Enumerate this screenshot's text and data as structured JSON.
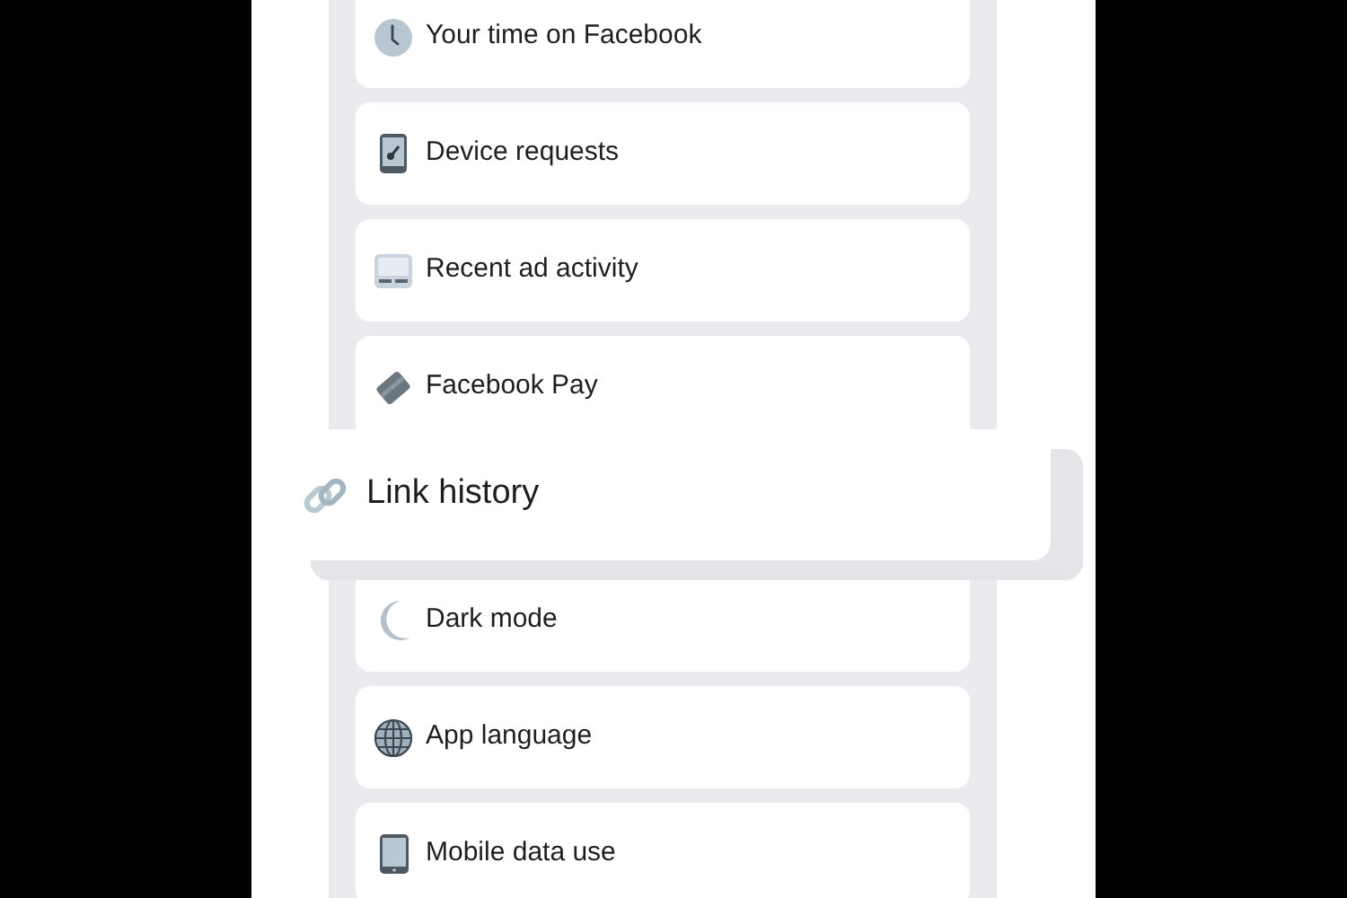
{
  "settings_items": [
    {
      "label": "Your time on Facebook",
      "magnified": false
    },
    {
      "label": "Device requests",
      "magnified": false
    },
    {
      "label": "Recent ad activity",
      "magnified": false
    },
    {
      "label": "Facebook Pay",
      "magnified": false
    },
    {
      "label": "Link history",
      "magnified": true
    },
    {
      "label": "Dark mode",
      "magnified": false
    },
    {
      "label": "App language",
      "magnified": false
    },
    {
      "label": "Mobile data use",
      "magnified": false
    }
  ]
}
